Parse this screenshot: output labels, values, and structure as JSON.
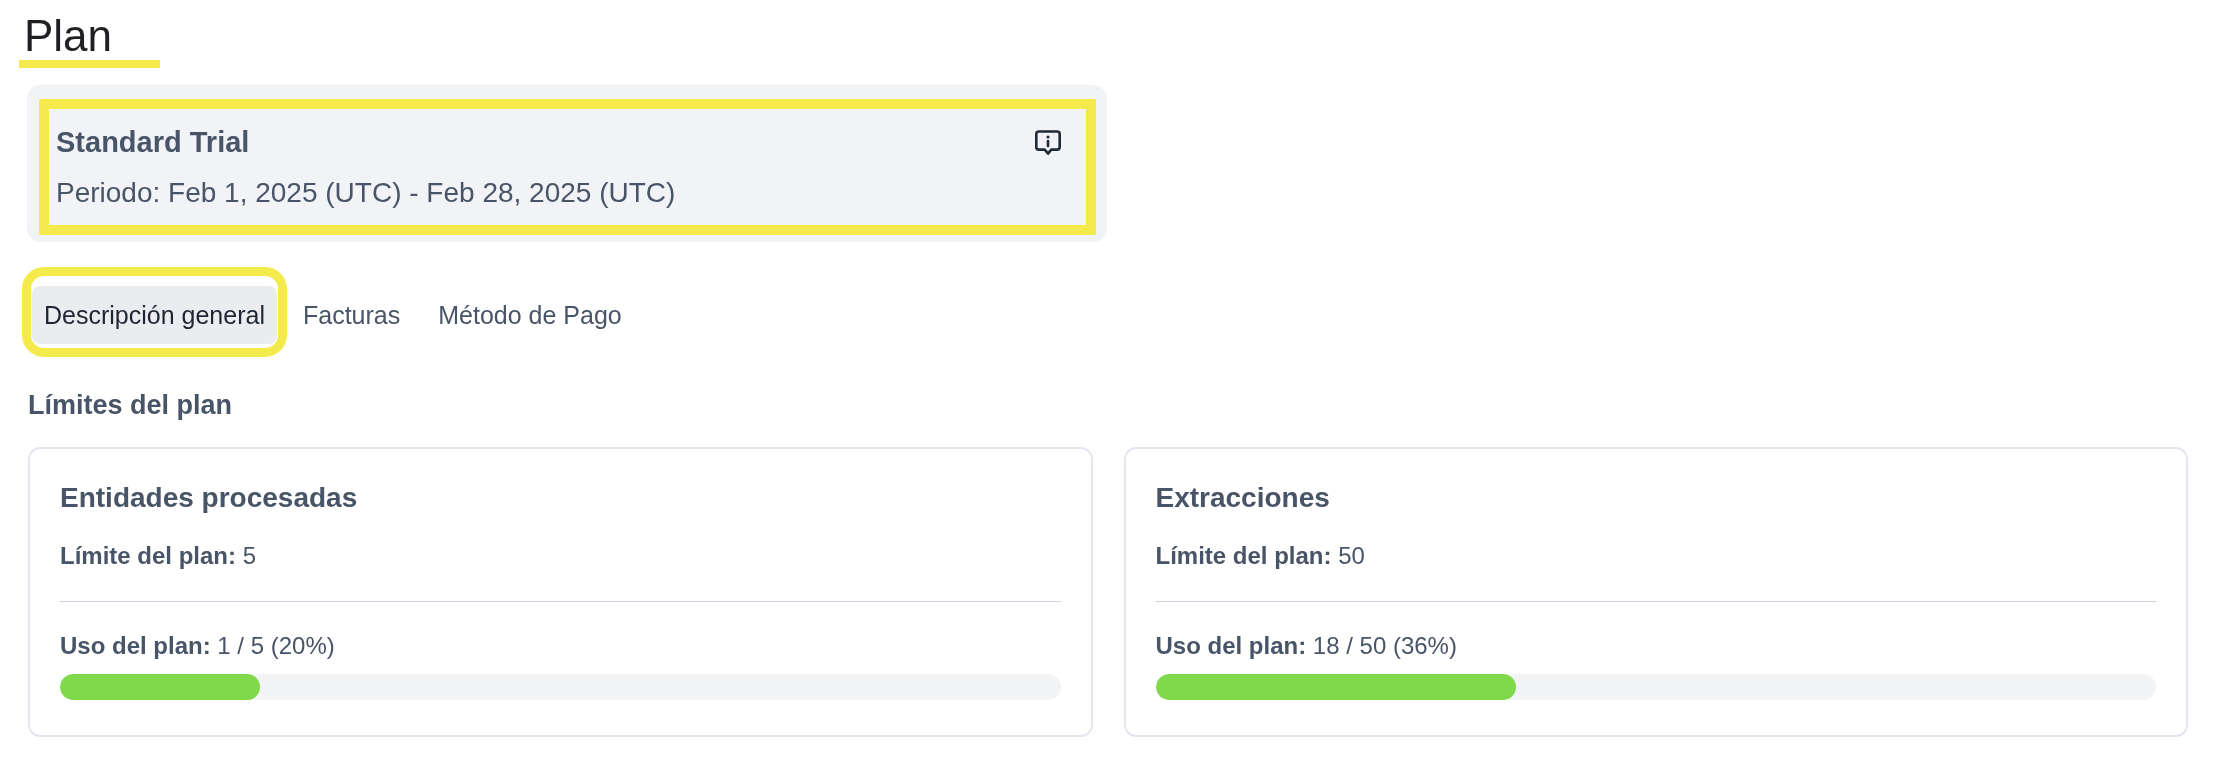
{
  "title": {
    "text": "Plan",
    "highlighted": true
  },
  "plan_card": {
    "name": "Standard Trial",
    "period": "Periodo: Feb 1, 2025 (UTC) - Feb 28, 2025 (UTC)",
    "highlighted": true
  },
  "tabs": [
    {
      "label": "Descripción general",
      "selected": true,
      "highlighted": true
    },
    {
      "label": "Facturas",
      "selected": false,
      "highlighted": false
    },
    {
      "label": "Método de Pago",
      "selected": false,
      "highlighted": false
    }
  ],
  "section_title": "Límites del plan",
  "limits": [
    {
      "title": "Entidades procesadas",
      "limit": "**Límite del plan:** 5",
      "usage": "**Uso del plan:** 1 / 5 (20%)",
      "level": 0.2
    },
    {
      "title": "Extracciones",
      "limit": "**Límite del plan:** 50",
      "usage": "**Uso del plan:** 18 / 50 (36%)",
      "level": 0.36
    }
  ]
}
